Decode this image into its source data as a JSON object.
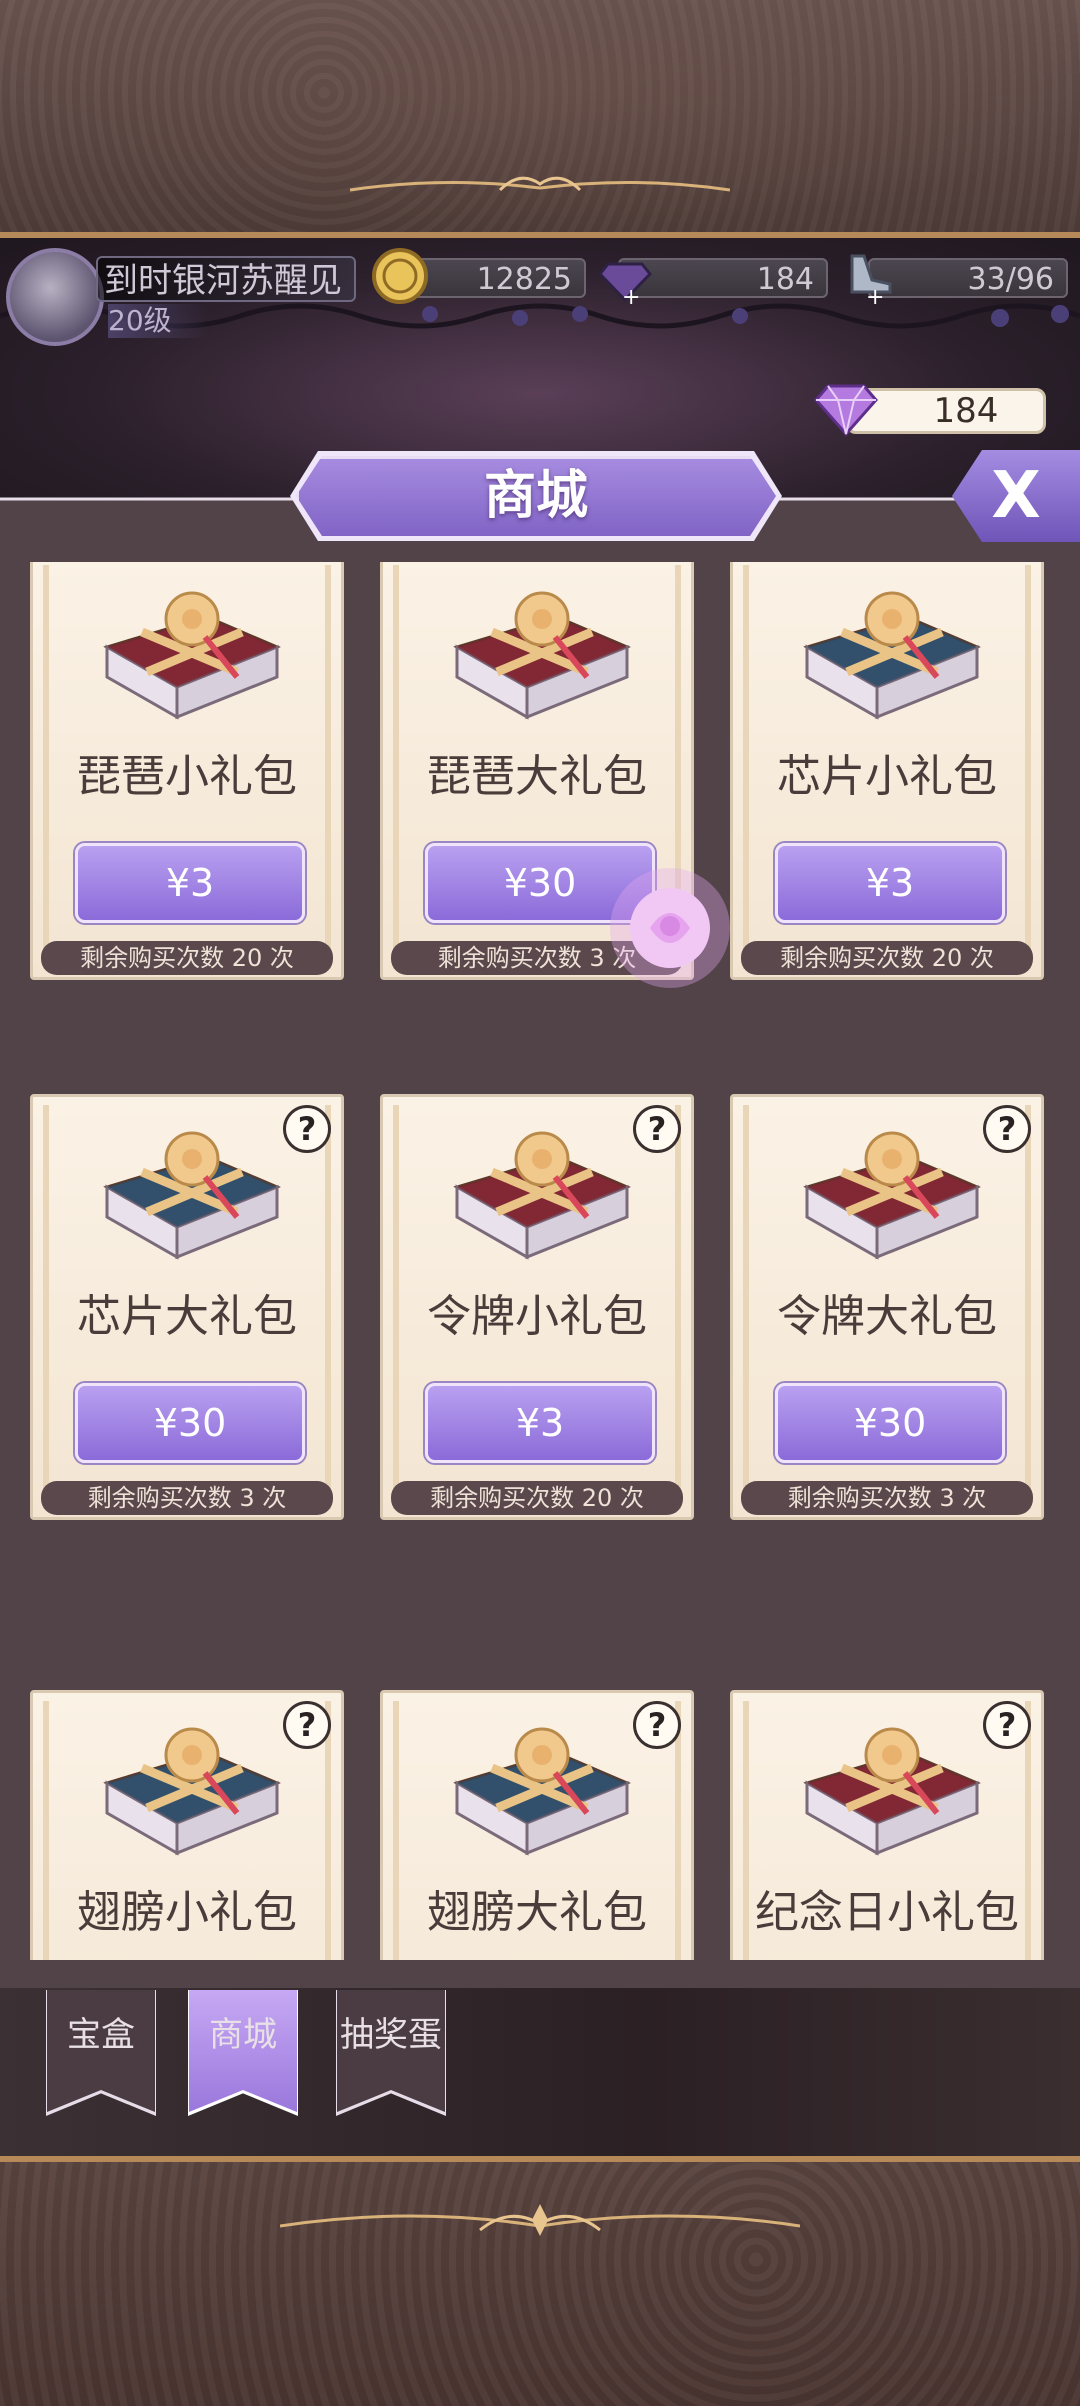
{
  "player": {
    "name": "到时银河苏醒见",
    "level": "20级"
  },
  "resources": {
    "gold": "12825",
    "gems": "184",
    "stamina": "33/96"
  },
  "diamond_balance": "184",
  "shop_title": "商城",
  "close_label": "X",
  "items": [
    {
      "name": "琵琶小礼包",
      "price": "¥3",
      "remaining": "剩余购买次数 20 次",
      "box_color": "red",
      "help": ""
    },
    {
      "name": "琵琶大礼包",
      "price": "¥30",
      "remaining": "剩余购买次数 3 次",
      "box_color": "red",
      "help": ""
    },
    {
      "name": "芯片小礼包",
      "price": "¥3",
      "remaining": "剩余购买次数 20 次",
      "box_color": "blue",
      "help": ""
    },
    {
      "name": "芯片大礼包",
      "price": "¥30",
      "remaining": "剩余购买次数 3 次",
      "box_color": "blue",
      "help": "?"
    },
    {
      "name": "令牌小礼包",
      "price": "¥3",
      "remaining": "剩余购买次数 20 次",
      "box_color": "red",
      "help": "?"
    },
    {
      "name": "令牌大礼包",
      "price": "¥30",
      "remaining": "剩余购买次数 3 次",
      "box_color": "red",
      "help": "?"
    },
    {
      "name": "翅膀小礼包",
      "price": "",
      "remaining": "",
      "box_color": "blue",
      "help": "?"
    },
    {
      "name": "翅膀大礼包",
      "price": "",
      "remaining": "",
      "box_color": "blue",
      "help": "?"
    },
    {
      "name": "纪念日小礼包",
      "price": "",
      "remaining": "",
      "box_color": "red",
      "help": "?"
    }
  ],
  "tabs": [
    {
      "label": "宝盒",
      "active": false
    },
    {
      "label": "商城",
      "active": true
    },
    {
      "label": "抽奖蛋",
      "active": false
    }
  ],
  "colors": {
    "accent_purple": "#8b6bd9",
    "card_bg": "#fbf2e6",
    "panel_bg": "#524349",
    "gold_trim": "#b58a58"
  }
}
